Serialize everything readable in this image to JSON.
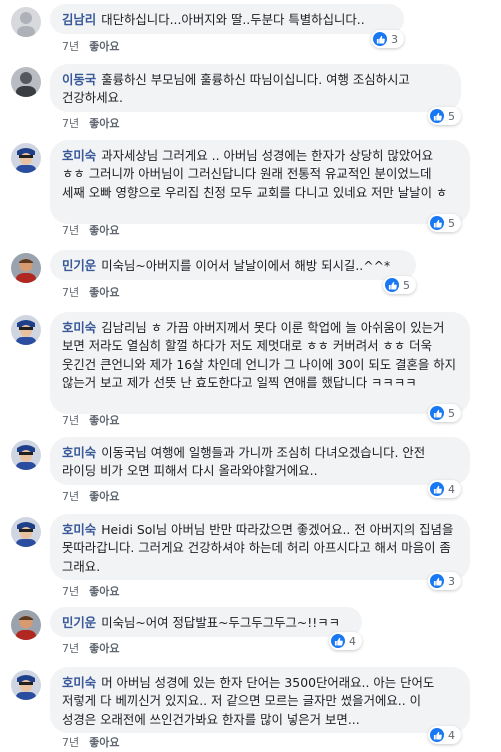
{
  "like_label": "좋아요",
  "comments": [
    {
      "author": "김남리",
      "text": "대단하십니다...아버지와 딸..두분다 특별하십니다..",
      "time": "7년",
      "reaction_count": "3"
    },
    {
      "author": "이동국",
      "text": "훌륭하신 부모님에 훌륭하신 따님이십니다. 여행 조심하시고 건강하세요.",
      "time": "7년",
      "reaction_count": "5"
    },
    {
      "author": "호미숙",
      "text": "과자세상님 그러게요 .. 아버님 성경에는 한자가 상당히 많았어요 ㅎㅎ 그러니까 아버님이 그러신답니다 원래 전통적 유교적인 분이었느데 세째 오빠 영향으로 우리집 친정 모두 교회를 다니고 있네요 저만 날날이 ㅎ",
      "time": "7년",
      "reaction_count": "5"
    },
    {
      "author": "민기운",
      "text": "미숙님~아버지를 이어서 날날이에서 해방 되시길..^^*",
      "time": "7년",
      "reaction_count": "5"
    },
    {
      "author": "호미숙",
      "text": "김남리님 ㅎ 가끔 아버지께서 못다 이룬 학업에 늘 아쉬움이 있는거 보면 저라도 열심히 할껄 하다가 저도 제멋대로 ㅎㅎ 커버려서 ㅎㅎ 더욱 웃긴건 큰언니와 제가 16살 차인데 언니가 그 나이에 30이 되도 결혼을 하지 않는거 보고 제가 선뜻 난 효도한다고 일찍 연애를 했답니다 ㅋㅋㅋㅋ",
      "time": "7년",
      "reaction_count": "5"
    },
    {
      "author": "호미숙",
      "text": "이동국님 여행에 일행들과 가니까 조심히 다녀오겠습니다. 안전 라이딩 비가 오면 피해서 다시 올라와야할거에요..",
      "time": "7년",
      "reaction_count": "4"
    },
    {
      "author": "호미숙",
      "text": "Heidi Sol님 아버님 반만 따라갔으면 좋겠어요.. 전 아버지의 집념을 못따라갑니다. 그러게요 건강하셔야 하는데 허리 아프시다고 해서 마음이 좀 그래요.",
      "time": "7년",
      "reaction_count": "3"
    },
    {
      "author": "민기운",
      "text": "미숙님~어여 정답발표~두그두그두그~!!ㅋㅋ",
      "time": "7년",
      "reaction_count": "4"
    },
    {
      "author": "호미숙",
      "text": "머 아버님 성경에 있는 한자 단어는 3500단어래요.. 아는 단어도 저렇게 다 베끼신거 있지요.. 저 같으면 모르는 글자만 썼을거에요.. 이 성경은 오래전에 쓰인건가봐요 한자를 많이 넣은거 보면...",
      "time": "7년",
      "reaction_count": "4"
    }
  ],
  "colors": {
    "author_link": "#385898",
    "bubble_bg": "#f2f3f5",
    "like_blue": "#1877f2",
    "meta_gray": "#606770"
  }
}
